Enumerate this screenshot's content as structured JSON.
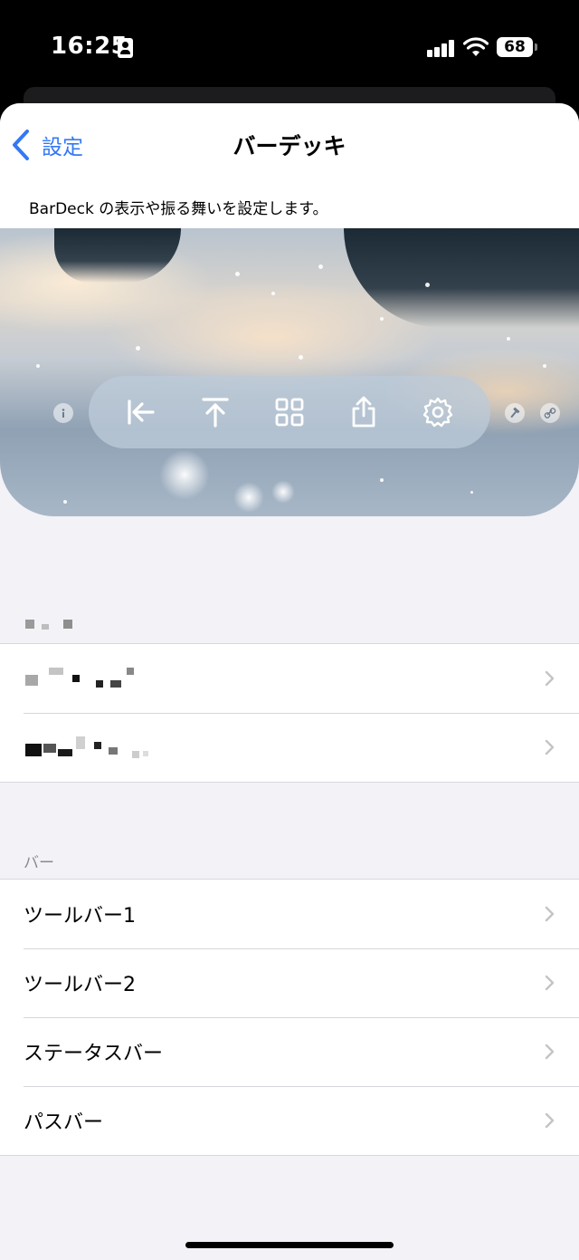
{
  "status_bar": {
    "time": "16:25",
    "battery": "68",
    "icons": [
      "id-card-icon",
      "cellular-signal-icon",
      "wifi-icon",
      "battery-icon"
    ]
  },
  "nav": {
    "back_label": "設定",
    "title": "バーデッキ"
  },
  "description": "BarDeck の表示や振る舞いを設定します。",
  "preview": {
    "toolbar_icons": [
      "arrow-left-to-line-icon",
      "arrow-up-to-line-icon",
      "grid-icon",
      "share-icon",
      "gear-icon"
    ],
    "side_icons": [
      "info-icon",
      "hammer-icon",
      "link-icon"
    ]
  },
  "bar_section": {
    "header": "バー",
    "items": [
      {
        "label": "ツールバー1"
      },
      {
        "label": "ツールバー2"
      },
      {
        "label": "ステータスバー"
      },
      {
        "label": "パスバー"
      }
    ]
  },
  "colors": {
    "accent": "#3478f6",
    "group_background": "#f2f2f7",
    "separator": "#d7d7dc",
    "secondary_text": "#8a8a8e"
  }
}
